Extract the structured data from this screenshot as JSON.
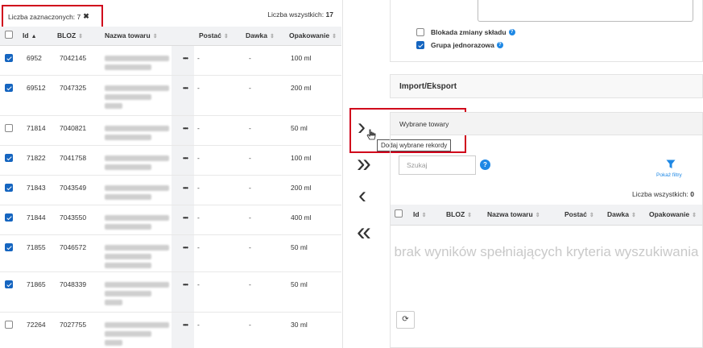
{
  "left": {
    "selected_label": "Liczba zaznaczonych: 7",
    "clear_selection": "✖",
    "total_label": "Liczba wszystkich:",
    "total_value": "17",
    "columns": [
      "Id",
      "BLOZ",
      "Nazwa towaru",
      "Postać",
      "Dawka",
      "Opakowanie"
    ],
    "rows": [
      {
        "checked": true,
        "id": "6952",
        "bloz": "7042145",
        "postac": "-",
        "dawka": "-",
        "opakowanie": "100 ml",
        "dots": "•••"
      },
      {
        "checked": true,
        "id": "69512",
        "bloz": "7047325",
        "postac": "-",
        "dawka": "-",
        "opakowanie": "200 ml",
        "dots": "•••"
      },
      {
        "checked": false,
        "id": "71814",
        "bloz": "7040821",
        "postac": "-",
        "dawka": "-",
        "opakowanie": "50 ml",
        "dots": "•••"
      },
      {
        "checked": true,
        "id": "71822",
        "bloz": "7041758",
        "postac": "-",
        "dawka": "-",
        "opakowanie": "100 ml",
        "dots": "•••"
      },
      {
        "checked": true,
        "id": "71843",
        "bloz": "7043549",
        "postac": "-",
        "dawka": "-",
        "opakowanie": "200 ml",
        "dots": "•••"
      },
      {
        "checked": true,
        "id": "71844",
        "bloz": "7043550",
        "postac": "-",
        "dawka": "-",
        "opakowanie": "400 ml",
        "dots": "•••"
      },
      {
        "checked": true,
        "id": "71855",
        "bloz": "7046572",
        "postac": "-",
        "dawka": "-",
        "opakowanie": "50 ml",
        "dots": "•••"
      },
      {
        "checked": true,
        "id": "71865",
        "bloz": "7048339",
        "postac": "-",
        "dawka": "-",
        "opakowanie": "50 ml",
        "dots": "•••"
      },
      {
        "checked": false,
        "id": "72264",
        "bloz": "7027755",
        "postac": "-",
        "dawka": "-",
        "opakowanie": "30 ml",
        "dots": "•••"
      }
    ]
  },
  "middle": {
    "add_selected": "›",
    "add_all": "»",
    "remove_selected": "‹",
    "remove_all": "«",
    "tooltip": "Dodaj wybrane rekordy"
  },
  "right": {
    "option_blokada": "Blokada zmiany składu",
    "option_grupa": "Grupa jednorazowa",
    "option_blokada_checked": false,
    "option_grupa_checked": true,
    "import_export": "Import/Eksport",
    "wybrane_title": "Wybrane towary",
    "search_placeholder": "Szukaj",
    "help_glyph": "?",
    "filter_label": "Pokaż filtry",
    "total_label": "Liczba wszystkich:",
    "total_value": "0",
    "columns": [
      "Id",
      "BLOZ",
      "Nazwa towaru",
      "Postać",
      "Dawka",
      "Opakowanie"
    ],
    "empty_text": "brak wyników spełniających kryteria wyszukiwania",
    "refresh_glyph": "⟳"
  },
  "colors": {
    "accent": "#1e88e5",
    "checkbox": "#1565c0",
    "highlight_border": "#d0021b"
  }
}
